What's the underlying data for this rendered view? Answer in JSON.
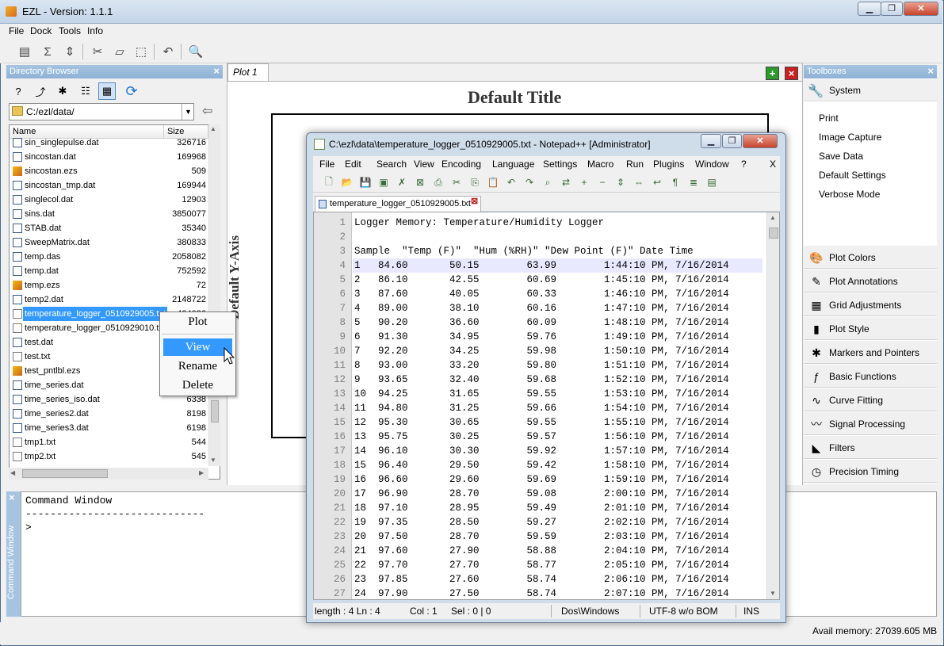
{
  "app": {
    "title": "EZL - Version: 1.1.1",
    "menu": [
      "File",
      "Dock",
      "Tools",
      "Info"
    ]
  },
  "directory": {
    "header": "Directory Browser",
    "path": "C:/ezl/data/",
    "columns": {
      "name": "Name",
      "size": "Size"
    },
    "files": [
      {
        "name": "sin_singlepulse.dat",
        "size": "326716",
        "type": "dat"
      },
      {
        "name": "sincostan.dat",
        "size": "169968",
        "type": "dat"
      },
      {
        "name": "sincostan.ezs",
        "size": "509",
        "type": "ezs"
      },
      {
        "name": "sincostan_tmp.dat",
        "size": "169944",
        "type": "dat"
      },
      {
        "name": "singlecol.dat",
        "size": "12903",
        "type": "dat"
      },
      {
        "name": "sins.dat",
        "size": "3850077",
        "type": "dat"
      },
      {
        "name": "STAB.dat",
        "size": "35340",
        "type": "dat"
      },
      {
        "name": "SweepMatrix.dat",
        "size": "380833",
        "type": "dat"
      },
      {
        "name": "temp.das",
        "size": "2058082",
        "type": "dat"
      },
      {
        "name": "temp.dat",
        "size": "752592",
        "type": "dat"
      },
      {
        "name": "temp.ezs",
        "size": "72",
        "type": "ezs"
      },
      {
        "name": "temp2.dat",
        "size": "2148722",
        "type": "dat"
      },
      {
        "name": "temperature_logger_0510929005.txt",
        "size": "434086",
        "type": "txt",
        "selected": true
      },
      {
        "name": "temperature_logger_0510929010.txt",
        "size": "",
        "type": "txt"
      },
      {
        "name": "test.dat",
        "size": "",
        "type": "dat"
      },
      {
        "name": "test.txt",
        "size": "",
        "type": "txt"
      },
      {
        "name": "test_pntlbl.ezs",
        "size": "",
        "type": "ezs"
      },
      {
        "name": "time_series.dat",
        "size": "",
        "type": "dat"
      },
      {
        "name": "time_series_iso.dat",
        "size": "6338",
        "type": "dat"
      },
      {
        "name": "time_series2.dat",
        "size": "8198",
        "type": "dat"
      },
      {
        "name": "time_series3.dat",
        "size": "6198",
        "type": "dat"
      },
      {
        "name": "tmp1.txt",
        "size": "544",
        "type": "txt"
      },
      {
        "name": "tmp2.txt",
        "size": "545",
        "type": "txt"
      }
    ]
  },
  "context_menu": [
    "Plot",
    "View",
    "Rename",
    "Delete"
  ],
  "plot": {
    "tab": "Plot 1",
    "title": "Default Title",
    "ylabel": "Default Y-Axis"
  },
  "toolboxes": {
    "header": "Toolboxes",
    "system": "System",
    "system_items": [
      "Print",
      "Image Capture",
      "Save Data",
      "Default Settings",
      "Verbose Mode"
    ],
    "boxes": [
      {
        "label": "Plot Colors",
        "icon": "palette-icon"
      },
      {
        "label": "Plot Annotations",
        "icon": "pencil-icon"
      },
      {
        "label": "Grid Adjustments",
        "icon": "grid-icon"
      },
      {
        "label": "Plot Style",
        "icon": "bars-icon"
      },
      {
        "label": "Markers and Pointers",
        "icon": "marker-icon"
      },
      {
        "label": "Basic Functions",
        "icon": "function-icon"
      },
      {
        "label": "Curve Fitting",
        "icon": "curve-icon"
      },
      {
        "label": "Signal Processing",
        "icon": "signal-icon"
      },
      {
        "label": "Filters",
        "icon": "filter-icon"
      },
      {
        "label": "Precision Timing",
        "icon": "timer-icon"
      }
    ]
  },
  "command": {
    "side_label": "Command Window",
    "lines": [
      "Command Window",
      "-----------------------------",
      ">"
    ]
  },
  "status": {
    "memory": "Avail memory: 27039.605 MB"
  },
  "notepad": {
    "title": "C:\\ezl\\data\\temperature_logger_0510929005.txt - Notepad++ [Administrator]",
    "menu": [
      "File",
      "Edit",
      "Search",
      "View",
      "Encoding",
      "Language",
      "Settings",
      "Macro",
      "Run",
      "Plugins",
      "Window",
      "?"
    ],
    "menu_close": "X",
    "tab": "temperature_logger_0510929005.txt",
    "lines": [
      "Logger Memory: Temperature/Humidity Logger",
      "",
      "Sample  \"Temp (F)\"  \"Hum (%RH)\" \"Dew Point (F)\" Date Time",
      "1   84.60       50.15        63.99        1:44:10 PM, 7/16/2014",
      "2   86.10       42.55        60.69        1:45:10 PM, 7/16/2014",
      "3   87.60       40.05        60.33        1:46:10 PM, 7/16/2014",
      "4   89.00       38.10        60.16        1:47:10 PM, 7/16/2014",
      "5   90.20       36.60        60.09        1:48:10 PM, 7/16/2014",
      "6   91.30       34.95        59.76        1:49:10 PM, 7/16/2014",
      "7   92.20       34.25        59.98        1:50:10 PM, 7/16/2014",
      "8   93.00       33.20        59.80        1:51:10 PM, 7/16/2014",
      "9   93.65       32.40        59.68        1:52:10 PM, 7/16/2014",
      "10  94.25       31.65        59.55        1:53:10 PM, 7/16/2014",
      "11  94.80       31.25        59.66        1:54:10 PM, 7/16/2014",
      "12  95.30       30.65        59.55        1:55:10 PM, 7/16/2014",
      "13  95.75       30.25        59.57        1:56:10 PM, 7/16/2014",
      "14  96.10       30.30        59.92        1:57:10 PM, 7/16/2014",
      "15  96.40       29.50        59.42        1:58:10 PM, 7/16/2014",
      "16  96.60       29.60        59.69        1:59:10 PM, 7/16/2014",
      "17  96.90       28.70        59.08        2:00:10 PM, 7/16/2014",
      "18  97.10       28.95        59.49        2:01:10 PM, 7/16/2014",
      "19  97.35       28.50        59.27        2:02:10 PM, 7/16/2014",
      "20  97.50       28.70        59.59        2:03:10 PM, 7/16/2014",
      "21  97.60       27.90        58.88        2:04:10 PM, 7/16/2014",
      "22  97.70       27.70        58.77        2:05:10 PM, 7/16/2014",
      "23  97.85       27.60        58.74        2:06:10 PM, 7/16/2014",
      "24  97.90       27.50        58.74        2:07:10 PM, 7/16/2014"
    ],
    "status": {
      "length": "length : 4  Ln : 4",
      "col": "Col : 1",
      "sel": "Sel : 0 | 0",
      "eol": "Dos\\Windows",
      "enc": "UTF-8 w/o BOM",
      "mode": "INS"
    }
  }
}
